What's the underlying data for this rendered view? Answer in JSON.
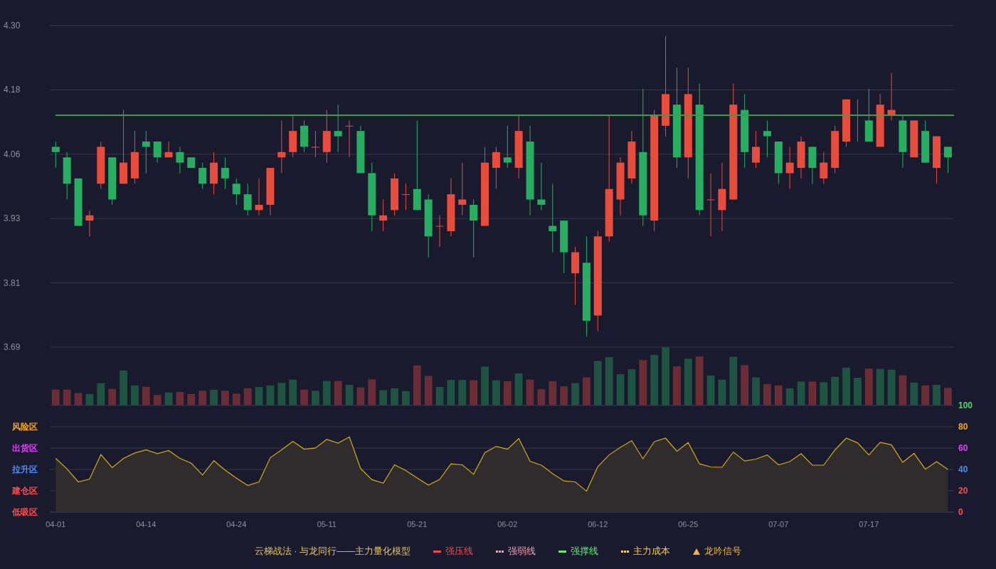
{
  "price_chart": {
    "chart_data": {
      "type": "candlestick",
      "grid": true,
      "ylim": [
        3.69,
        4.3
      ],
      "yticks": [
        {
          "value": 4.3,
          "label": "4.30"
        },
        {
          "value": 4.178,
          "label": "4.18"
        },
        {
          "value": 4.056,
          "label": "4.06"
        },
        {
          "value": 3.934,
          "label": "3.93"
        },
        {
          "value": 3.812,
          "label": "3.81"
        },
        {
          "value": 3.69,
          "label": "3.69"
        }
      ],
      "categories": [
        null,
        null,
        null,
        null,
        null,
        null,
        null,
        null,
        null,
        null,
        null,
        null,
        null,
        null,
        null,
        null,
        null,
        null,
        null,
        null,
        null,
        null,
        null,
        null,
        null,
        null,
        null,
        null,
        null,
        null,
        null,
        null,
        null,
        null,
        null,
        null,
        null,
        null,
        null,
        null,
        null,
        null,
        null,
        null,
        null,
        null,
        null,
        null,
        null,
        null,
        null,
        null,
        null,
        null,
        null,
        null,
        null,
        null,
        null,
        null,
        null,
        null,
        null,
        null,
        null,
        null,
        null,
        null,
        null,
        null,
        null,
        null,
        null,
        null,
        null,
        null,
        null,
        null,
        null,
        null
      ],
      "ohlc": [
        [
          4.07,
          4.08,
          4.03,
          4.06
        ],
        [
          4.05,
          4.06,
          3.97,
          4.0
        ],
        [
          4.01,
          4.01,
          3.92,
          3.92
        ],
        [
          3.93,
          3.95,
          3.9,
          3.94
        ],
        [
          4.0,
          4.08,
          3.99,
          4.07
        ],
        [
          4.05,
          4.05,
          3.96,
          3.97
        ],
        [
          4.0,
          4.14,
          4.0,
          4.04
        ],
        [
          4.01,
          4.1,
          4.0,
          4.06
        ],
        [
          4.08,
          4.1,
          4.02,
          4.07
        ],
        [
          4.08,
          4.08,
          4.04,
          4.05
        ],
        [
          4.05,
          4.08,
          4.05,
          4.06
        ],
        [
          4.06,
          4.07,
          4.02,
          4.04
        ],
        [
          4.05,
          4.05,
          4.03,
          4.03
        ],
        [
          4.03,
          4.04,
          3.99,
          4.0
        ],
        [
          4.0,
          4.06,
          3.98,
          4.04
        ],
        [
          4.03,
          4.05,
          3.99,
          4.01
        ],
        [
          4.0,
          4.01,
          3.96,
          3.98
        ],
        [
          3.98,
          4.0,
          3.94,
          3.95
        ],
        [
          3.95,
          4.01,
          3.94,
          3.96
        ],
        [
          3.96,
          4.03,
          3.94,
          4.03
        ],
        [
          4.05,
          4.12,
          4.02,
          4.06
        ],
        [
          4.06,
          4.13,
          4.05,
          4.1
        ],
        [
          4.11,
          4.12,
          4.06,
          4.07
        ],
        [
          4.07,
          4.1,
          4.05,
          4.07
        ],
        [
          4.06,
          4.14,
          4.04,
          4.1
        ],
        [
          4.1,
          4.15,
          4.06,
          4.09
        ],
        [
          4.11,
          4.12,
          4.05,
          4.11
        ],
        [
          4.1,
          4.11,
          4.02,
          4.02
        ],
        [
          4.02,
          4.04,
          3.91,
          3.94
        ],
        [
          3.93,
          3.97,
          3.91,
          3.94
        ],
        [
          3.95,
          4.02,
          3.94,
          4.01
        ],
        [
          3.98,
          4.0,
          3.95,
          3.98
        ],
        [
          3.99,
          4.12,
          3.95,
          3.95
        ],
        [
          3.97,
          3.98,
          3.86,
          3.9
        ],
        [
          3.92,
          3.94,
          3.88,
          3.92
        ],
        [
          3.91,
          4.01,
          3.9,
          3.98
        ],
        [
          3.96,
          4.04,
          3.94,
          3.97
        ],
        [
          3.96,
          3.97,
          3.86,
          3.93
        ],
        [
          3.92,
          4.07,
          3.92,
          4.04
        ],
        [
          4.03,
          4.07,
          3.99,
          4.06
        ],
        [
          4.05,
          4.11,
          4.03,
          4.04
        ],
        [
          4.03,
          4.13,
          4.01,
          4.1
        ],
        [
          4.08,
          4.11,
          3.94,
          3.97
        ],
        [
          3.97,
          4.04,
          3.95,
          3.96
        ],
        [
          3.92,
          4.0,
          3.87,
          3.91
        ],
        [
          3.93,
          3.93,
          3.83,
          3.87
        ],
        [
          3.83,
          3.88,
          3.77,
          3.87
        ],
        [
          3.85,
          3.9,
          3.71,
          3.74
        ],
        [
          3.75,
          3.91,
          3.72,
          3.9
        ],
        [
          3.9,
          4.13,
          3.89,
          3.99
        ],
        [
          3.97,
          4.05,
          3.94,
          4.04
        ],
        [
          4.01,
          4.1,
          4.0,
          4.08
        ],
        [
          4.06,
          4.18,
          3.92,
          3.94
        ],
        [
          3.93,
          4.14,
          3.91,
          4.13
        ],
        [
          4.11,
          4.28,
          4.09,
          4.17
        ],
        [
          4.15,
          4.22,
          4.03,
          4.05
        ],
        [
          4.05,
          4.22,
          4.01,
          4.17
        ],
        [
          4.15,
          4.19,
          3.94,
          3.95
        ],
        [
          3.97,
          4.02,
          3.9,
          3.97
        ],
        [
          3.95,
          4.04,
          3.91,
          3.99
        ],
        [
          3.97,
          4.19,
          3.97,
          4.15
        ],
        [
          4.14,
          4.17,
          4.03,
          4.06
        ],
        [
          4.04,
          4.1,
          4.03,
          4.07
        ],
        [
          4.1,
          4.12,
          4.05,
          4.09
        ],
        [
          4.08,
          4.08,
          4.0,
          4.02
        ],
        [
          4.02,
          4.07,
          3.99,
          4.04
        ],
        [
          4.03,
          4.09,
          4.01,
          4.08
        ],
        [
          4.07,
          4.07,
          4.0,
          4.03
        ],
        [
          4.01,
          4.06,
          4.0,
          4.04
        ],
        [
          4.03,
          4.11,
          4.02,
          4.1
        ],
        [
          4.08,
          4.16,
          4.07,
          4.16
        ],
        [
          4.13,
          4.16,
          4.08,
          4.13
        ],
        [
          4.12,
          4.18,
          4.08,
          4.08
        ],
        [
          4.07,
          4.17,
          4.07,
          4.15
        ],
        [
          4.13,
          4.21,
          4.12,
          4.14
        ],
        [
          4.12,
          4.13,
          4.03,
          4.06
        ],
        [
          4.05,
          4.12,
          4.05,
          4.12
        ],
        [
          4.1,
          4.12,
          4.04,
          4.04
        ],
        [
          4.03,
          4.09,
          4.0,
          4.09
        ],
        [
          4.07,
          4.07,
          4.02,
          4.05
        ]
      ],
      "ref_lines": [
        {
          "axis": "y",
          "value": 4.13
        }
      ]
    }
  },
  "indicator": {
    "zones": [
      {
        "label": "风险区",
        "color": "#f5a623"
      },
      {
        "label": "出货区",
        "color": "#e040fb"
      },
      {
        "label": "拉升区",
        "color": "#4a8dff"
      },
      {
        "label": "建仓区",
        "color": "#ff4d4f"
      },
      {
        "label": "低吸区",
        "color": "#ff4d4f"
      }
    ],
    "ytick_styles": [
      {
        "color": "#4cd964"
      },
      {
        "color": "#f5a623"
      },
      {
        "color": "#e040fb"
      },
      {
        "color": "#4a8dff"
      },
      {
        "color": "#ff4d4f"
      },
      {
        "color": "#ff4d4f"
      }
    ],
    "chart_data": {
      "type": "area",
      "grid": true,
      "ylim": [
        0,
        100
      ],
      "yticks": [
        {
          "value": 100,
          "label": "100"
        },
        {
          "value": 80,
          "label": "80"
        },
        {
          "value": 60,
          "label": "60"
        },
        {
          "value": 40,
          "label": "40"
        },
        {
          "value": 20,
          "label": "20"
        },
        {
          "value": 0,
          "label": "0"
        }
      ],
      "categories": [
        "04-01",
        null,
        null,
        null,
        null,
        null,
        null,
        null,
        "04-14",
        null,
        null,
        null,
        null,
        null,
        null,
        null,
        "04-24",
        null,
        null,
        null,
        null,
        null,
        null,
        null,
        "05-11",
        null,
        null,
        null,
        null,
        null,
        null,
        null,
        "05-21",
        null,
        null,
        null,
        null,
        null,
        null,
        null,
        "06-02",
        null,
        null,
        null,
        null,
        null,
        null,
        null,
        "06-12",
        null,
        null,
        null,
        null,
        null,
        null,
        null,
        "06-25",
        null,
        null,
        null,
        null,
        null,
        null,
        null,
        "07-07",
        null,
        null,
        null,
        null,
        null,
        null,
        null,
        "07-17",
        null,
        null,
        null,
        null,
        null,
        null,
        null
      ],
      "values": [
        50.3,
        40.5,
        28.3,
        31.0,
        53.9,
        41.7,
        50.3,
        55.4,
        58.3,
        54.8,
        57.7,
        50.3,
        45.8,
        34.8,
        48.2,
        39.3,
        31.8,
        25.0,
        28.3,
        50.9,
        58.3,
        66.4,
        58.9,
        60.1,
        68.2,
        64.6,
        70.5,
        40.8,
        30.4,
        27.1,
        44.3,
        39.0,
        32.1,
        25.3,
        30.7,
        45.2,
        44.3,
        35.4,
        55.7,
        61.6,
        58.9,
        69.0,
        47.6,
        44.0,
        36.0,
        29.2,
        28.3,
        19.6,
        42.6,
        53.6,
        60.7,
        67.0,
        50.0,
        66.1,
        69.3,
        57.1,
        65.2,
        45.2,
        42.3,
        42.0,
        56.3,
        47.9,
        49.7,
        53.6,
        44.3,
        47.3,
        54.8,
        44.0,
        44.0,
        58.3,
        69.3,
        64.9,
        53.6,
        65.5,
        63.1,
        46.7,
        55.1,
        40.2,
        47.3,
        39.9
      ]
    }
  },
  "legend": {
    "title": "云梯战法 · 与龙同行——主力量化模型",
    "items": [
      {
        "label": "强压线",
        "kind": "solid",
        "color": "#ff4444"
      },
      {
        "label": "强弱线",
        "kind": "dashed",
        "color": "#ff9cb4"
      },
      {
        "label": "强撑线",
        "kind": "solid",
        "color": "#5cf06a"
      },
      {
        "label": "主力成本",
        "kind": "dashed",
        "color": "#ffd21f"
      },
      {
        "label": "龙吟信号",
        "kind": "triangle",
        "color": "#f2b53a"
      }
    ]
  }
}
